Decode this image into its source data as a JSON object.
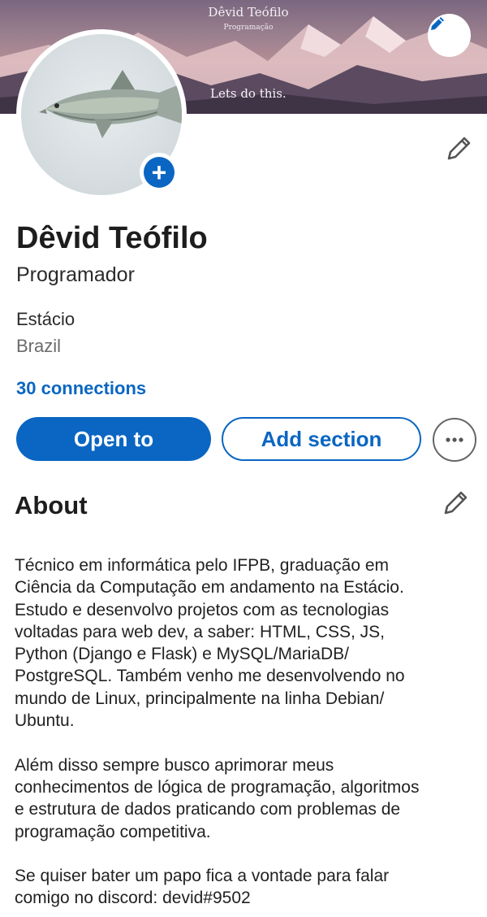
{
  "banner": {
    "name": "Dêvid Teófilo",
    "subtitle": "Programação",
    "tagline": "Lets do this."
  },
  "profile": {
    "name": "Dêvid Teófilo",
    "headline": "Programador",
    "school": "Estácio",
    "location": "Brazil",
    "connections": "30 connections"
  },
  "actions": {
    "open_to": "Open to",
    "add_section": "Add section"
  },
  "about": {
    "title": "About",
    "text": "Técnico em informática pelo IFPB, graduação em\nCiência da Computação em andamento na Estácio.\nEstudo e desenvolvo projetos com as tecnologias\nvoltadas para web dev, a saber: HTML, CSS, JS,\nPython (Django e Flask) e MySQL/MariaDB/\nPostgreSQL. Também venho me desenvolvendo no\nmundo de Linux, principalmente na linha Debian/\nUbuntu.\n\nAlém disso sempre busco aprimorar meus\nconhecimentos de lógica de programação, algoritmos\ne estrutura de dados praticando com problemas de\nprogramação competitiva.\n\nSe quiser bater um papo fica a vontade para falar\ncomigo no discord: devid#9502"
  },
  "colors": {
    "accent": "#0a66c2",
    "text": "#1d1d1d",
    "muted": "#6b6b6b"
  },
  "icons": {
    "banner_edit": "pencil-icon",
    "avatar_add": "plus-icon",
    "intro_edit": "pencil-icon",
    "about_edit": "pencil-icon",
    "more": "ellipsis-icon"
  }
}
